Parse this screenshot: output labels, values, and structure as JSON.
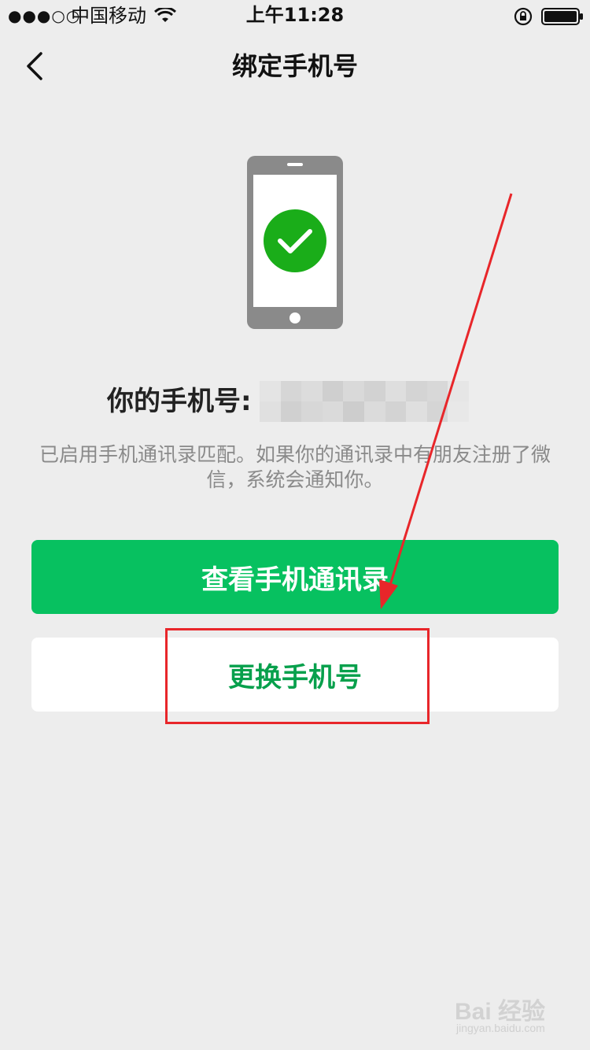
{
  "status_bar": {
    "signal": "●●●○○",
    "carrier": "中国移动",
    "time": "上午11:28",
    "icons": [
      "wifi-icon",
      "orientation-lock-icon",
      "battery-icon"
    ]
  },
  "nav": {
    "title": "绑定手机号",
    "back_icon": "chevron-left-icon"
  },
  "illustration": {
    "icon": "phone-checkmark-icon",
    "phone_color": "#8a8a8a",
    "check_color": "#1aad19"
  },
  "phone_number": {
    "label": "你的手机号:"
  },
  "description": {
    "text": "已启用手机通讯录匹配。如果你的通讯录中有朋友注册了微信，系统会通知你。"
  },
  "actions": {
    "view_contacts_label": "查看手机通讯录",
    "change_number_label": "更换手机号"
  },
  "colors": {
    "accent": "#07c160",
    "secondary_text": "#07a04c",
    "background": "#ededed",
    "annotation": "#e8262a"
  },
  "watermark": {
    "main": "Bai 经验",
    "sub": "jingyan.baidu.com"
  }
}
